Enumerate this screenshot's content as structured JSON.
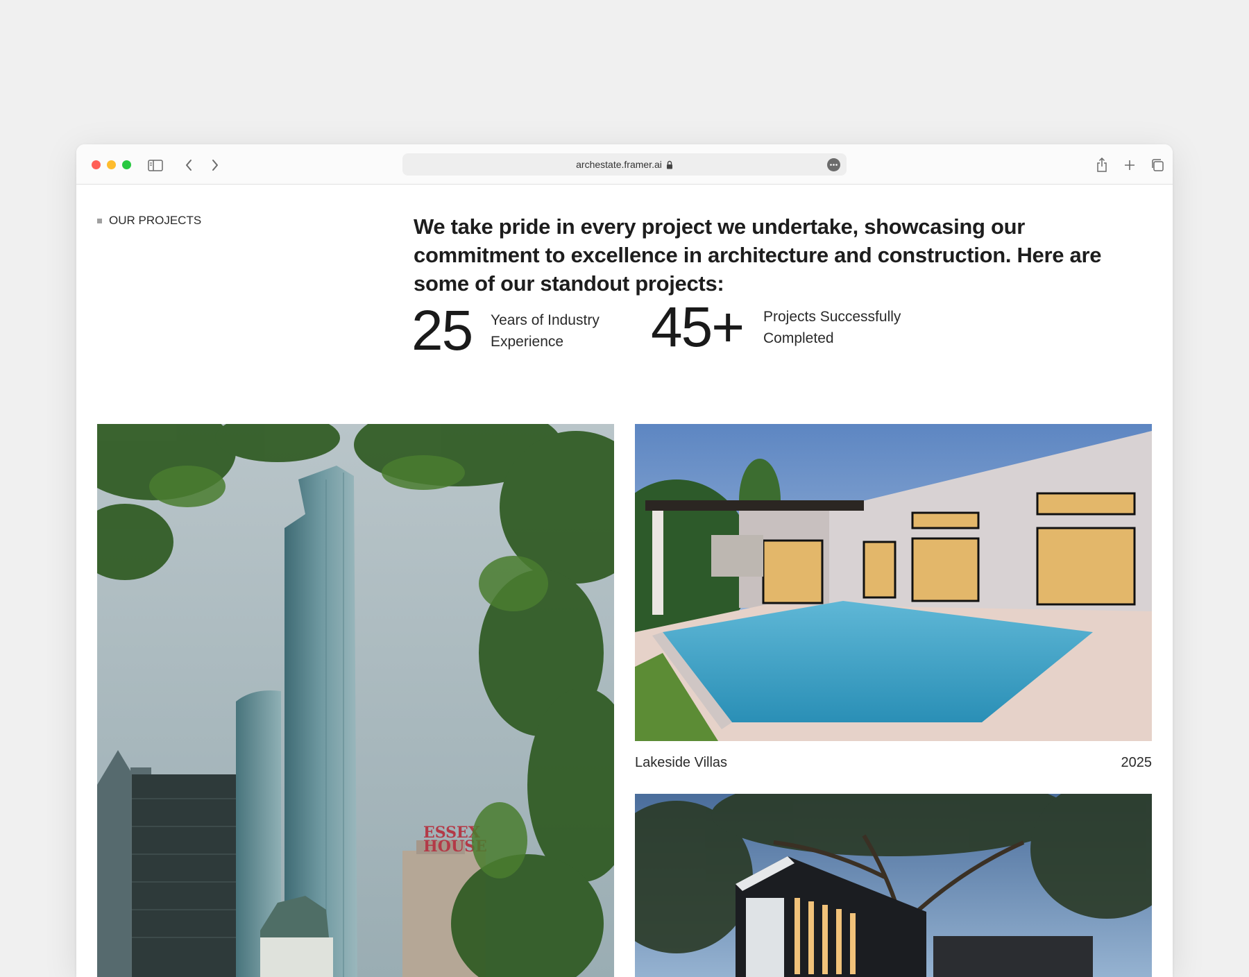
{
  "browser": {
    "url": "archestate.framer.ai"
  },
  "section": {
    "label": "OUR PROJECTS"
  },
  "intro": {
    "headline": "We take pride in every project we undertake, showcasing our commitment to excellence in architecture and construction. Here are some of our standout projects:"
  },
  "stats": [
    {
      "value": "25",
      "label_line1": "Years of Industry",
      "label_line2": "Experience"
    },
    {
      "value": "45+",
      "label_line1": "Projects Successfully",
      "label_line2": "Completed"
    }
  ],
  "projects": [
    {
      "name": "Lakeside Villas",
      "year": "2025"
    }
  ],
  "photos": {
    "tall_sign_line1": "ESSEX",
    "tall_sign_line2": "HOUSE"
  },
  "colors": {
    "page_bg": "#f0f0f0",
    "close": "#ff5f57",
    "minimize": "#febc2e",
    "zoom": "#28c840",
    "text": "#1d1d1d"
  },
  "icons": [
    "sidebar-icon",
    "back-icon",
    "forward-icon",
    "lock-icon",
    "more-icon",
    "share-icon",
    "new-tab-icon",
    "tabs-overview-icon"
  ]
}
